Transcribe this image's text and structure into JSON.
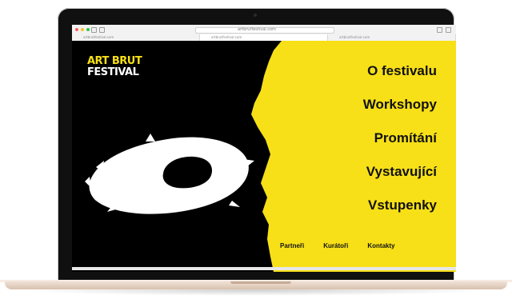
{
  "browser": {
    "url": "artbrutfestival.com",
    "tabs": [
      "artbrutfestival.com",
      "artbrutfestival.com",
      "artbrutfestival.com"
    ]
  },
  "site": {
    "logo_line1": "ART BRUT",
    "logo_line2": "FESTIVAL",
    "menu": [
      "O festivalu",
      "Workshopy",
      "Promítání",
      "Vystavující",
      "Vstupenky"
    ],
    "footer_links": [
      "Partneři",
      "Kurátoři",
      "Kontakty"
    ]
  },
  "colors": {
    "accent_yellow": "#f7e017",
    "background_black": "#000000",
    "laptop_gold": "#d9c1ad"
  },
  "icons": [
    "close-dot-icon",
    "minimize-dot-icon",
    "maximize-dot-icon",
    "back-icon",
    "forward-icon",
    "share-icon",
    "new-tab-icon"
  ]
}
